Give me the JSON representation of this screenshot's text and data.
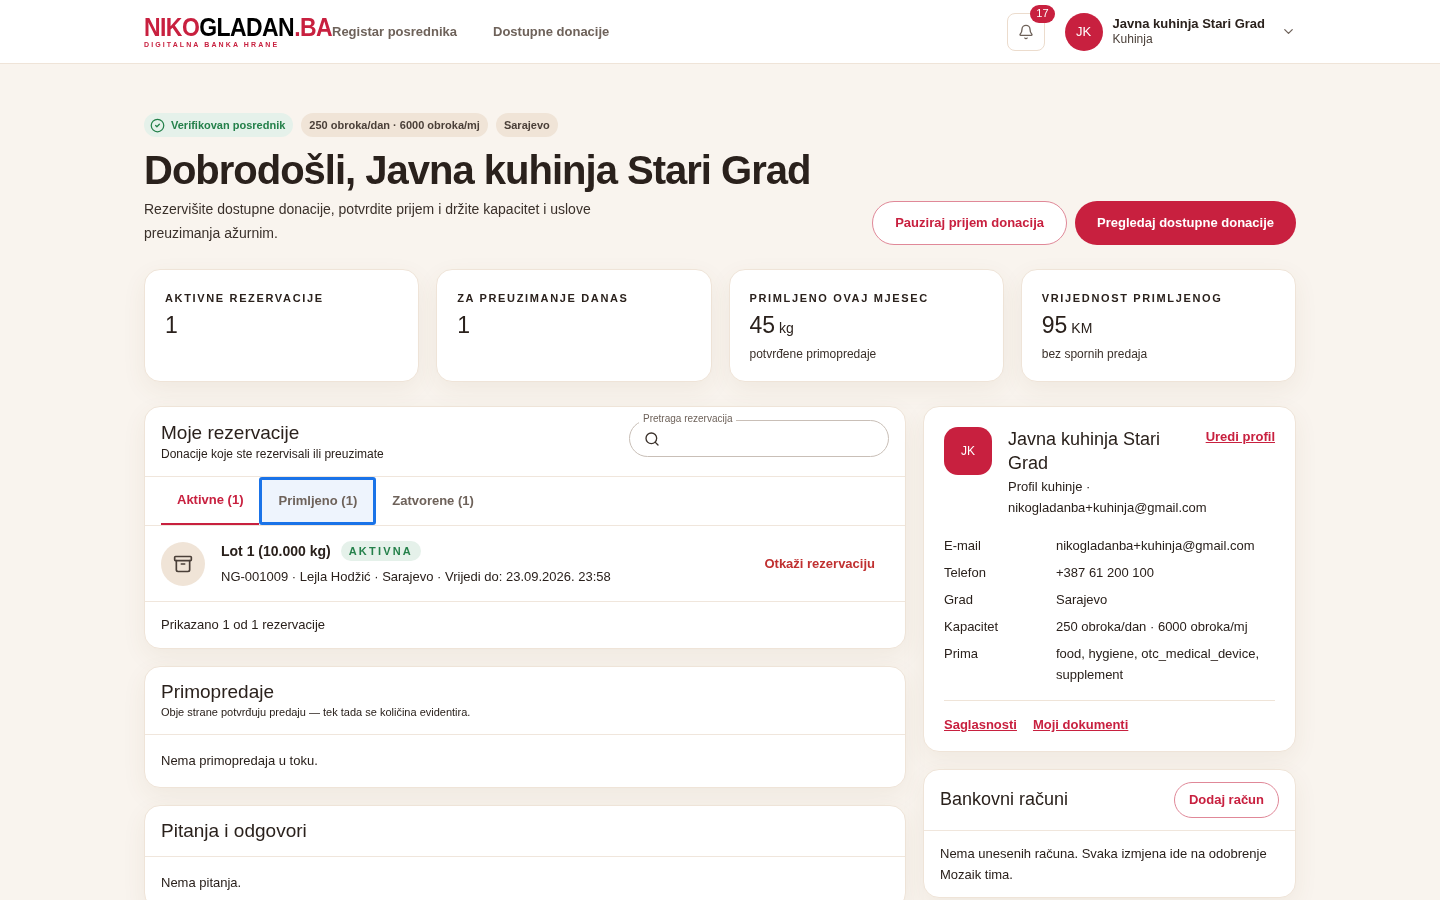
{
  "header": {
    "logo": {
      "part_1": "NIKO",
      "part_2": "GLADAN",
      "part_3": ".BA",
      "tagline": "DIGITALNA BANKA HRANE"
    },
    "nav": [
      "Registar posrednika",
      "Dostupne donacije"
    ],
    "notifications": {
      "count": "17"
    },
    "user": {
      "initials": "JK",
      "name": "Javna kuhinja Stari Grad",
      "role": "Kuhinja"
    }
  },
  "badges": [
    {
      "kind": "verified",
      "label": "Verifikovan posrednik"
    },
    {
      "kind": "plain",
      "label": "250 obroka/dan · 6000 obroka/mj"
    },
    {
      "kind": "plain",
      "label": "Sarajevo"
    }
  ],
  "title": "Dobrodošli, Javna kuhinja Stari Grad",
  "subtitle": "Rezervišite dostupne donacije, potvrdite prijem i držite kapacitet i uslove preuzimanja ažurnim.",
  "actions": [
    {
      "kind": "outline",
      "label": "Pauziraj prijem donacija"
    },
    {
      "kind": "primary",
      "label": "Pregledaj dostupne donacije"
    }
  ],
  "stats": [
    {
      "label": "AKTIVNE REZERVACIJE",
      "value": "1"
    },
    {
      "label": "ZA PREUZIMANJE DANAS",
      "value": "1"
    },
    {
      "label": "PRIMLJENO OVAJ MJESEC",
      "value": "45",
      "unit": "kg",
      "note": "potvrđene primopredaje"
    },
    {
      "label": "VRIJEDNOST PRIMLJENOG",
      "value": "95",
      "unit": "KM",
      "note": "bez spornih predaja"
    }
  ],
  "reservations": {
    "title": "Moje rezervacije",
    "subtitle": "Donacije koje ste rezervisali ili preuzimate",
    "search_label": "Pretraga rezervacija",
    "tabs": [
      {
        "label": "Aktivne (1)",
        "selected": true,
        "focused": false
      },
      {
        "label": "Primljeno (1)",
        "selected": false,
        "focused": true
      },
      {
        "label": "Zatvorene (1)",
        "selected": false,
        "focused": false
      }
    ],
    "items": [
      {
        "title": "Lot 1 (10.000 kg)",
        "status": "AKTIVNA",
        "details": "NG-001009 · Lejla Hodžić · Sarajevo · Vrijedi do: 23.09.2026. 23:58",
        "action": "Otkaži rezervaciju"
      }
    ],
    "footer": "Prikazano 1 od 1 rezervacije"
  },
  "handovers": {
    "title": "Primopredaje",
    "subtitle": "Obje strane potvrđuju predaju — tek tada se količina evidentira.",
    "empty": "Nema primopredaja u toku."
  },
  "qa": {
    "title": "Pitanja i odgovori",
    "empty": "Nema pitanja."
  },
  "profile": {
    "initials": "JK",
    "name": "Javna kuhinja Stari Grad",
    "subtitle": "Profil kuhinje · nikogladanba+kuhinja@gmail.com",
    "edit": "Uredi profil",
    "fields": [
      {
        "label": "E-mail",
        "value": "nikogladanba+kuhinja@gmail.com"
      },
      {
        "label": "Telefon",
        "value": "+387 61 200 100"
      },
      {
        "label": "Grad",
        "value": "Sarajevo"
      },
      {
        "label": "Kapacitet",
        "value": "250 obroka/dan · 6000 obroka/mj"
      },
      {
        "label": "Prima",
        "value": "food, hygiene, otc_medical_device, supplement"
      }
    ],
    "links": [
      "Saglasnosti",
      "Moji dokumenti"
    ]
  },
  "bank": {
    "title": "Bankovni računi",
    "action": "Dodaj račun",
    "empty": "Nema unesenih računa. Svaka izmjena ide na odobrenje Mozaik tima."
  }
}
